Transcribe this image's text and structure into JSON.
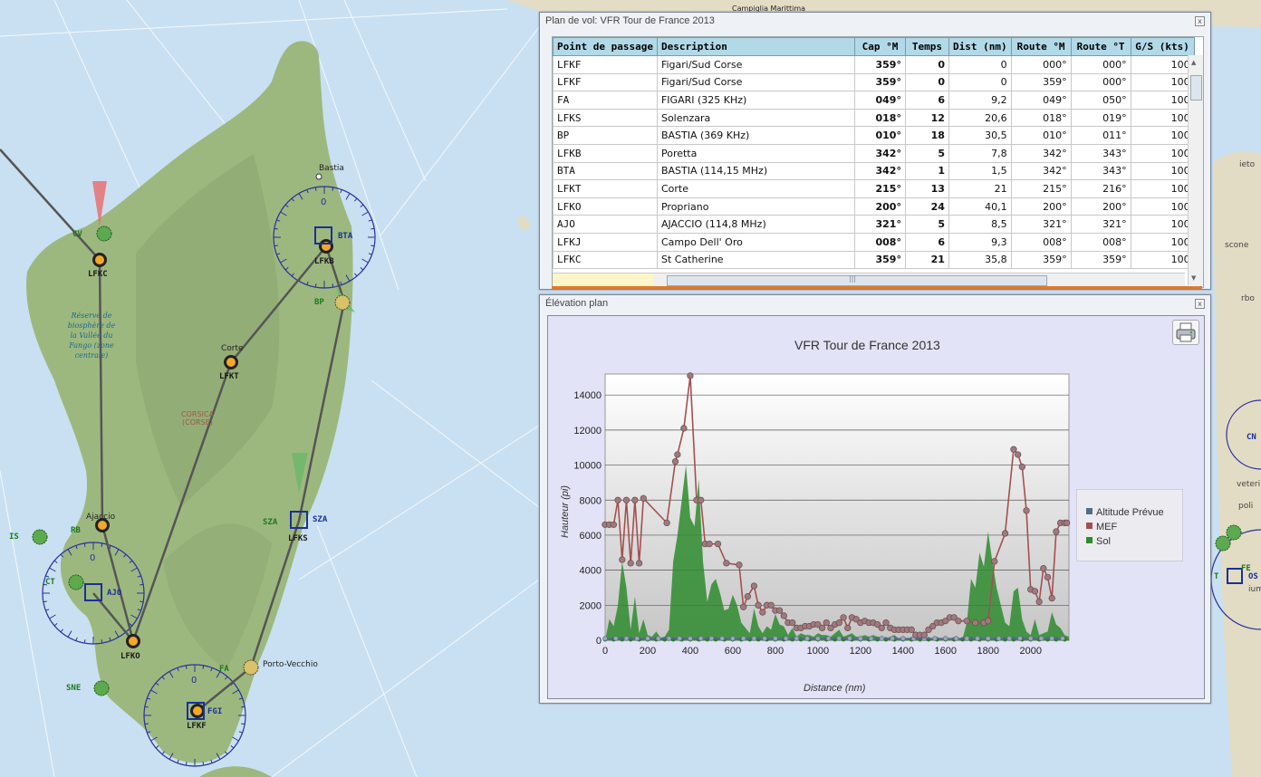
{
  "map": {
    "place_labels": [
      "Bastia",
      "Corte",
      "Ajaccio",
      "Porto-Vecchio",
      "Campiglia Marittima"
    ],
    "region_label": [
      "CORSICA",
      "(CORSE)"
    ],
    "reserve_label": [
      "Réserve de",
      "biosphère de",
      "la Vallée du",
      "Fango (zone",
      "centrale)"
    ],
    "waypoints": [
      "LFKC",
      "LFKB",
      "LFKT",
      "LFKS",
      "LFKO",
      "LFKF"
    ],
    "navaids": [
      "BTA",
      "BP",
      "SZA",
      "AJO",
      "FGI",
      "FA",
      "CV",
      "CT",
      "RB",
      "IS",
      "SNE",
      "CN",
      "FE",
      "OS",
      "T"
    ],
    "compass_zero": "0",
    "edge_labels": [
      "ieto",
      "scone",
      "rbo",
      "veteri",
      "poli",
      "iumi"
    ]
  },
  "plan": {
    "title": "Plan de vol: VFR Tour de France 2013",
    "close": "x",
    "headers": [
      "Point de passage",
      "Description",
      "Cap °M",
      "Temps",
      "Dist (nm)",
      "Route °M",
      "Route °T",
      "G/S (kts)"
    ],
    "rows": [
      [
        "LFKF",
        "Figari/Sud Corse",
        "359°",
        "0",
        "0",
        "000°",
        "000°",
        "100"
      ],
      [
        "LFKF",
        "Figari/Sud Corse",
        "359°",
        "0",
        "0",
        "359°",
        "000°",
        "100"
      ],
      [
        "FA",
        "FIGARI (325 KHz)",
        "049°",
        "6",
        "9,2",
        "049°",
        "050°",
        "100"
      ],
      [
        "LFKS",
        "Solenzara",
        "018°",
        "12",
        "20,6",
        "018°",
        "019°",
        "100"
      ],
      [
        "BP",
        "BASTIA (369 KHz)",
        "010°",
        "18",
        "30,5",
        "010°",
        "011°",
        "100"
      ],
      [
        "LFKB",
        "Poretta",
        "342°",
        "5",
        "7,8",
        "342°",
        "343°",
        "100"
      ],
      [
        "BTA",
        "BASTIA (114,15 MHz)",
        "342°",
        "1",
        "1,5",
        "342°",
        "343°",
        "100"
      ],
      [
        "LFKT",
        "Corte",
        "215°",
        "13",
        "21",
        "215°",
        "216°",
        "100"
      ],
      [
        "LFKO",
        "Propriano",
        "200°",
        "24",
        "40,1",
        "200°",
        "200°",
        "100"
      ],
      [
        "AJO",
        "AJACCIO (114,8 MHz)",
        "321°",
        "5",
        "8,5",
        "321°",
        "321°",
        "100"
      ],
      [
        "LFKJ",
        "Campo Dell' Oro",
        "008°",
        "6",
        "9,3",
        "008°",
        "008°",
        "100"
      ],
      [
        "LFKC",
        "St Catherine",
        "359°",
        "21",
        "35,8",
        "359°",
        "359°",
        "100"
      ]
    ],
    "scroll_grip": "|||"
  },
  "elevation": {
    "title": "Élévation plan",
    "close": "x",
    "print_icon": "printer-icon"
  },
  "chart_data": {
    "type": "line",
    "title": "VFR Tour de France 2013",
    "xlabel": "Distance (nm)",
    "ylabel": "Hauteur (pi)",
    "xlim": [
      0,
      2180
    ],
    "ylim": [
      0,
      15200
    ],
    "xticks": [
      0,
      200,
      400,
      600,
      800,
      1000,
      1200,
      1400,
      1600,
      1800,
      2000
    ],
    "yticks": [
      0,
      2000,
      4000,
      6000,
      8000,
      10000,
      12000,
      14000
    ],
    "legend": [
      "Altitude Prévue",
      "MEF",
      "Sol"
    ],
    "legend_position": "right",
    "colors": {
      "altitude": "#4f6d8a",
      "mef": "#a35050",
      "mef_marker": "#9c7a7e",
      "sol": "#2e8b2e",
      "plot_bg_top": "#ffffff",
      "plot_bg_bottom": "#c8c8c8"
    },
    "series": [
      {
        "name": "MEF",
        "x": [
          0,
          20,
          40,
          60,
          80,
          100,
          120,
          140,
          160,
          180,
          290,
          330,
          340,
          370,
          400,
          430,
          450,
          470,
          490,
          530,
          570,
          630,
          650,
          670,
          700,
          720,
          740,
          760,
          780,
          800,
          820,
          840,
          860,
          880,
          900,
          920,
          940,
          960,
          980,
          1000,
          1020,
          1040,
          1060,
          1080,
          1100,
          1120,
          1140,
          1160,
          1180,
          1200,
          1220,
          1240,
          1260,
          1280,
          1300,
          1320,
          1340,
          1360,
          1380,
          1400,
          1420,
          1440,
          1460,
          1480,
          1500,
          1520,
          1540,
          1560,
          1580,
          1600,
          1620,
          1640,
          1660,
          1700,
          1740,
          1780,
          1800,
          1830,
          1880,
          1920,
          1940,
          1960,
          1980,
          2000,
          2020,
          2040,
          2060,
          2080,
          2100,
          2120,
          2140,
          2160,
          2170
        ],
        "values": [
          6600,
          6600,
          6600,
          8000,
          4600,
          8000,
          4400,
          8000,
          4400,
          8100,
          6700,
          10200,
          10600,
          12100,
          15100,
          8000,
          8000,
          5500,
          5500,
          5500,
          4400,
          4300,
          1900,
          2500,
          3100,
          2000,
          1600,
          2000,
          2000,
          1700,
          1700,
          1400,
          1000,
          1000,
          700,
          700,
          800,
          800,
          900,
          900,
          700,
          1000,
          700,
          900,
          1000,
          1300,
          700,
          1300,
          1200,
          1000,
          1100,
          1000,
          1000,
          900,
          700,
          1000,
          700,
          600,
          600,
          600,
          600,
          600,
          300,
          300,
          300,
          600,
          800,
          1000,
          1000,
          1100,
          1300,
          1300,
          1100,
          1100,
          1000,
          1000,
          1100,
          4500,
          6100,
          10900,
          10600,
          9900,
          7400,
          2900,
          2800,
          2200,
          4100,
          3600,
          2400,
          6200,
          6700,
          6700,
          6700
        ]
      },
      {
        "name": "Sol",
        "x": [
          0,
          20,
          40,
          60,
          80,
          100,
          120,
          140,
          160,
          180,
          200,
          220,
          240,
          260,
          280,
          300,
          320,
          340,
          360,
          380,
          400,
          420,
          440,
          460,
          480,
          500,
          520,
          540,
          560,
          580,
          600,
          620,
          640,
          660,
          680,
          700,
          720,
          740,
          760,
          780,
          800,
          820,
          840,
          860,
          880,
          900,
          920,
          940,
          960,
          980,
          1000,
          1020,
          1040,
          1060,
          1080,
          1100,
          1120,
          1140,
          1160,
          1180,
          1200,
          1220,
          1240,
          1260,
          1280,
          1300,
          1320,
          1340,
          1360,
          1380,
          1400,
          1420,
          1440,
          1460,
          1480,
          1500,
          1520,
          1540,
          1560,
          1580,
          1600,
          1620,
          1640,
          1660,
          1680,
          1700,
          1720,
          1740,
          1760,
          1780,
          1800,
          1820,
          1840,
          1860,
          1880,
          1900,
          1920,
          1940,
          1960,
          1980,
          2000,
          2020,
          2040,
          2060,
          2080,
          2100,
          2120,
          2140,
          2160,
          2180
        ],
        "values": [
          0,
          1200,
          800,
          2000,
          4500,
          3000,
          600,
          2500,
          400,
          1200,
          300,
          200,
          500,
          150,
          200,
          600,
          4500,
          6000,
          8000,
          10000,
          7000,
          6500,
          9200,
          4500,
          2200,
          3200,
          3500,
          2700,
          1700,
          1800,
          2600,
          2000,
          1000,
          700,
          400,
          1800,
          800,
          400,
          800,
          600,
          1500,
          900,
          800,
          300,
          700,
          200,
          400,
          300,
          300,
          200,
          400,
          300,
          300,
          200,
          400,
          600,
          200,
          300,
          400,
          200,
          200,
          300,
          200,
          300,
          200,
          200,
          100,
          200,
          300,
          100,
          200,
          100,
          100,
          100,
          200,
          100,
          100,
          100,
          50,
          100,
          50,
          50,
          100,
          50,
          100,
          1000,
          3500,
          3000,
          5000,
          4200,
          6200,
          4500,
          3000,
          2000,
          1000,
          800,
          2800,
          3000,
          1200,
          500,
          300,
          1200,
          300,
          400,
          500,
          1600,
          900,
          700,
          300,
          200
        ]
      },
      {
        "name": "Altitude Prévue",
        "x": [
          0,
          50,
          100,
          150,
          200,
          250,
          300,
          350,
          400,
          450,
          500,
          550,
          600,
          650,
          700,
          750,
          800,
          850,
          900,
          950,
          1000,
          1050,
          1100,
          1150,
          1200,
          1250,
          1300,
          1350,
          1400,
          1450,
          1500,
          1550,
          1600,
          1650,
          1700,
          1750,
          1800,
          1850,
          1900,
          1950,
          2000,
          2050,
          2100,
          2150
        ],
        "values": [
          100,
          100,
          100,
          100,
          100,
          100,
          100,
          100,
          100,
          100,
          100,
          100,
          100,
          100,
          100,
          100,
          100,
          100,
          100,
          100,
          100,
          100,
          100,
          100,
          100,
          100,
          100,
          100,
          100,
          100,
          100,
          100,
          100,
          100,
          100,
          100,
          100,
          100,
          100,
          100,
          100,
          100,
          100,
          100
        ]
      }
    ]
  }
}
